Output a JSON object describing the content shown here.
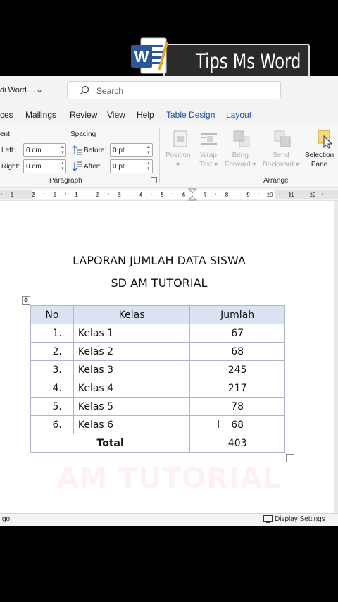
{
  "banner": {
    "title": "Tips Ms Word",
    "logo_letter": "W"
  },
  "titlebar": {
    "doc_name": "di Word....",
    "search_label": "Search"
  },
  "menu": {
    "tabs": [
      "ces",
      "Mailings",
      "Review",
      "View",
      "Help",
      "Table Design",
      "Layout"
    ]
  },
  "ribbon": {
    "indent_label": "ent",
    "spacing_label": "Spacing",
    "left_label": "Left:",
    "right_label": "Right:",
    "left_value": "0 cm",
    "right_value": "0 cm",
    "before_label": "Before:",
    "after_label": "After:",
    "before_value": "0 pt",
    "after_value": "0 pt",
    "paragraph_group": "Paragraph",
    "arrange_group": "Arrange",
    "buttons": {
      "position": [
        "Position",
        "▾"
      ],
      "wrap_text": [
        "Wrap",
        "Text ▾"
      ],
      "bring_forward": [
        "Bring",
        "Forward ▾"
      ],
      "send_backward": [
        "Send",
        "Backward ▾"
      ],
      "selection_pane": [
        "Selection",
        "Pane"
      ]
    }
  },
  "ruler": {
    "labels": [
      "1",
      "2",
      "1",
      "1",
      "2",
      "3",
      "4",
      "5",
      "6",
      "7",
      "8",
      "9",
      "10",
      "11",
      "12"
    ]
  },
  "document": {
    "title_line1": "LAPORAN JUMLAH DATA SISWA",
    "title_line2": "SD AM TUTORIAL",
    "table": {
      "headers": [
        "No",
        "Kelas",
        "Jumlah"
      ],
      "rows": [
        [
          "1.",
          "Kelas 1",
          "67"
        ],
        [
          "2.",
          "Kelas 2",
          "68"
        ],
        [
          "3.",
          "Kelas 3",
          "245"
        ],
        [
          "4.",
          "Kelas 4",
          "217"
        ],
        [
          "5.",
          "Kelas 5",
          "78"
        ],
        [
          "6.",
          "Kelas 6",
          "68"
        ]
      ],
      "total_label": "Total",
      "total_value": "403"
    },
    "watermark": "AM TUTORIAL"
  },
  "status": {
    "left_text": "go",
    "display_settings": "Display Settings"
  },
  "colors": {
    "word_blue": "#2b579a",
    "table_header": "#dbe3f2",
    "context_tab": "#1f56a5"
  }
}
